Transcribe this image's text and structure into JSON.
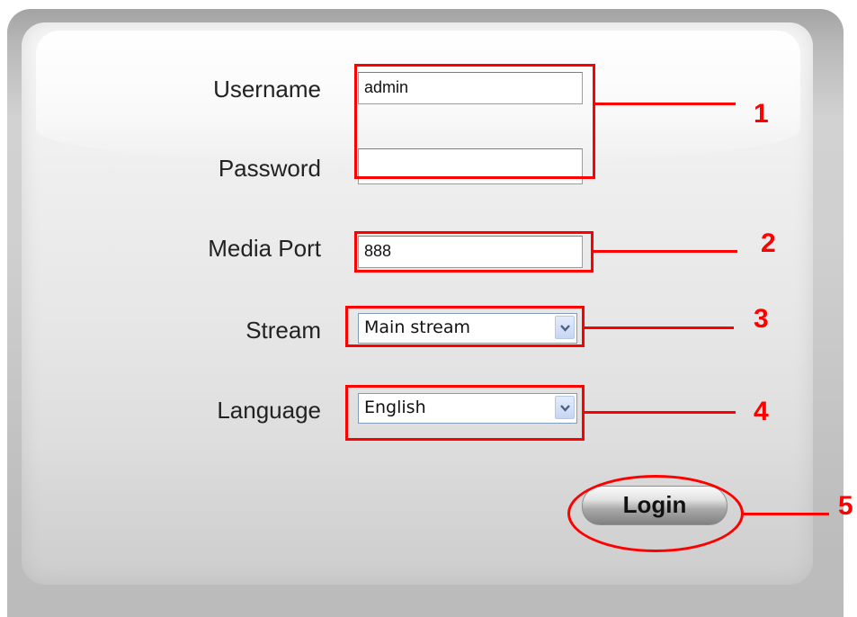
{
  "form": {
    "username": {
      "label": "Username",
      "value": "admin"
    },
    "password": {
      "label": "Password",
      "value": ""
    },
    "media_port": {
      "label": "Media Port",
      "value": "888"
    },
    "stream": {
      "label": "Stream",
      "selected": "Main stream"
    },
    "language": {
      "label": "Language",
      "selected": "English"
    },
    "login_label": "Login"
  },
  "annotations": {
    "n1": "1",
    "n2": "2",
    "n3": "3",
    "n4": "4",
    "n5": "5"
  },
  "icons": {
    "dropdown_arrow": "chevron-down-icon"
  },
  "colors": {
    "annotation": "#ff0000",
    "panel": "#d2d2d2"
  }
}
